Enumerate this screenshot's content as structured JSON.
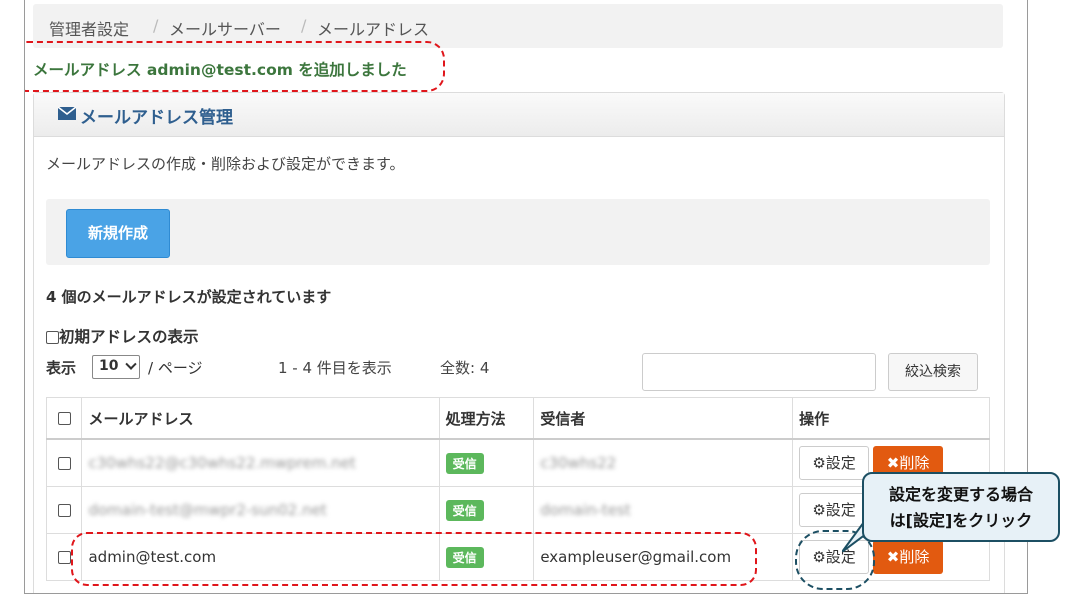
{
  "breadcrumb": [
    "管理者設定",
    "メールサーバー",
    "メールアドレス"
  ],
  "flash_message": "メールアドレス admin@test.com を追加しました",
  "panel": {
    "title": "メールアドレス管理",
    "description": "メールアドレスの作成・削除および設定ができます。",
    "new_button": "新規作成"
  },
  "summary": {
    "count_text": "4 個のメールアドレスが設定されています",
    "initial_address_label": "初期アドレスの表示"
  },
  "paging": {
    "show_label": "表示",
    "per_page": "10",
    "per_page_suffix": "/ ページ",
    "range_text": "1 - 4 件目を表示",
    "total_text": "全数: 4"
  },
  "search": {
    "placeholder": "",
    "button": "絞込検索"
  },
  "table": {
    "headers": [
      "メールアドレス",
      "処理方法",
      "受信者",
      "操作"
    ],
    "rows": [
      {
        "email": "c30whs22@c30whs22.mwprem.net",
        "method": "受信",
        "recipient": "c30whs22",
        "blurred": true
      },
      {
        "email": "domain-test@mwpr2-sun02.net",
        "method": "受信",
        "recipient": "domain-test",
        "blurred": true
      },
      {
        "email": "admin@test.com",
        "method": "受信",
        "recipient": "exampleuser@gmail.com",
        "blurred": false
      }
    ],
    "settings_button": "設定",
    "delete_button": "削除"
  },
  "callout": {
    "line1": "設定を変更する場合",
    "line2": "は[設定]をクリック"
  },
  "colors": {
    "success_text": "#3c763d",
    "primary_button": "#4aa3e6",
    "danger_button": "#e25a10",
    "badge": "#5cb85c",
    "annotation_red": "#e0161b",
    "annotation_navy": "#1c4f63"
  }
}
